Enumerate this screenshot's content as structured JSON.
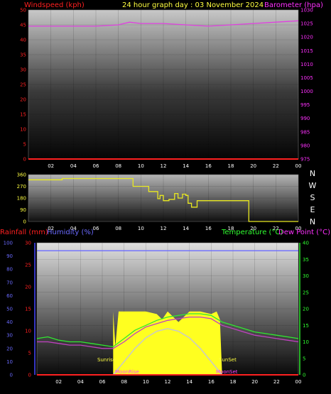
{
  "header": {
    "title": "24 hour graph day : 03 November 2024",
    "left_label": "Windspeed (kph)",
    "right_label": "Barometer (hpa)"
  },
  "compass": [
    "N",
    "W",
    "S",
    "E",
    "N"
  ],
  "panel3": {
    "left_label_1": "Rainfall (mm)",
    "left_label_2": "Humidity (%)",
    "right_label_1": "Temperature (°C)",
    "right_label_2": "Dew Point (°C)",
    "sunrise_label": "Sunrise",
    "sunset_label": "SunSet",
    "moonrise_label": "MoonRise",
    "moonset_label": "MoonSet"
  },
  "chart_data": [
    {
      "type": "line",
      "x_ticks": [
        "02",
        "04",
        "06",
        "08",
        "10",
        "12",
        "14",
        "16",
        "18",
        "20",
        "22",
        "00"
      ],
      "yleft_ticks": [
        0,
        5,
        10,
        15,
        20,
        25,
        30,
        35,
        40,
        45,
        50
      ],
      "yleft_lim": [
        0,
        50
      ],
      "yright_ticks": [
        975,
        980,
        985,
        990,
        995,
        1000,
        1005,
        1010,
        1015,
        1020,
        1025,
        1030
      ],
      "yright_lim": [
        975,
        1030
      ],
      "series": [
        {
          "name": "Windspeed (kph)",
          "axis": "left",
          "color": "#ff2020",
          "x": [
            0,
            24
          ],
          "values": [
            0,
            0
          ]
        },
        {
          "name": "Barometer (hpa)",
          "axis": "right",
          "color": "#e040e0",
          "x": [
            0,
            2,
            4,
            6,
            8,
            9,
            10,
            12,
            14,
            16,
            18,
            20,
            22,
            24
          ],
          "values": [
            1024,
            1024,
            1024,
            1024,
            1024.5,
            1025.5,
            1025,
            1025,
            1024.5,
            1024,
            1024.5,
            1025,
            1025.5,
            1026
          ]
        }
      ]
    },
    {
      "type": "line",
      "x_ticks": [
        "02",
        "04",
        "06",
        "08",
        "10",
        "12",
        "14",
        "16",
        "18",
        "20",
        "22",
        "00"
      ],
      "y_ticks": [
        0,
        90,
        180,
        270,
        360
      ],
      "ylim": [
        0,
        360
      ],
      "series": [
        {
          "name": "Wind direction",
          "color": "#e8e820",
          "x": [
            0,
            2,
            3,
            5,
            8,
            9,
            9.3,
            10.5,
            10.7,
            11,
            11.5,
            11.7,
            12,
            12.5,
            13,
            13.3,
            13.7,
            14,
            14.2,
            14.5,
            15,
            17,
            18,
            19,
            19.5,
            19.6,
            24
          ],
          "values": [
            320,
            320,
            330,
            330,
            330,
            330,
            270,
            270,
            230,
            230,
            175,
            200,
            160,
            170,
            215,
            180,
            210,
            200,
            140,
            110,
            160,
            160,
            160,
            160,
            160,
            0,
            0
          ]
        }
      ]
    },
    {
      "type": "line",
      "x_ticks": [
        "02",
        "04",
        "06",
        "08",
        "10",
        "12",
        "14",
        "16",
        "18",
        "20",
        "22",
        "00"
      ],
      "yleft1_ticks": [
        0,
        5,
        10,
        15,
        20,
        25,
        30
      ],
      "yleft1_lim": [
        0,
        30
      ],
      "yleft2_ticks": [
        0,
        10,
        20,
        30,
        40,
        50,
        60,
        70,
        80,
        90,
        100
      ],
      "yleft2_lim": [
        0,
        100
      ],
      "yright_ticks": [
        0,
        5,
        10,
        15,
        20,
        25,
        30,
        35,
        40
      ],
      "yright_lim": [
        0,
        40
      ],
      "series": [
        {
          "name": "Temperature (°C)",
          "axis": "right",
          "color": "#30e830",
          "x": [
            0,
            1,
            2,
            3,
            4,
            5,
            6,
            7,
            8,
            9,
            10,
            11,
            12,
            13,
            14,
            15,
            16,
            17,
            18,
            19,
            20,
            21,
            22,
            23,
            24
          ],
          "values": [
            11,
            11.5,
            10.5,
            10,
            10,
            9.5,
            9,
            8.5,
            11,
            13.5,
            15,
            16.5,
            17.5,
            18,
            18.5,
            18.5,
            18,
            16,
            15,
            14,
            13,
            12.5,
            12,
            11.5,
            11
          ]
        },
        {
          "name": "Dew Point (°C)",
          "axis": "right",
          "color": "#c040c0",
          "x": [
            0,
            1,
            2,
            3,
            4,
            5,
            6,
            7,
            8,
            9,
            10,
            11,
            12,
            13,
            14,
            15,
            16,
            17,
            18,
            19,
            20,
            21,
            22,
            23,
            24
          ],
          "values": [
            10,
            10,
            9.5,
            9,
            9,
            8.5,
            8,
            8,
            10,
            12.5,
            14.5,
            15.5,
            16.5,
            17,
            17.5,
            17.5,
            17,
            15,
            14,
            13,
            12,
            11.5,
            11,
            10.5,
            10
          ]
        },
        {
          "name": "Humidity (%)",
          "axis": "left2",
          "color": "#6a6aff",
          "x": [
            0,
            24
          ],
          "values": [
            94,
            94
          ]
        },
        {
          "name": "Solar",
          "axis": "left2",
          "color": "#ffff20",
          "x": [
            7.0,
            7.2,
            7.5,
            8,
            9,
            10,
            11,
            11.5,
            12,
            12.5,
            13,
            14,
            15,
            16,
            16.5,
            16.8,
            17.0
          ],
          "values": [
            48,
            22,
            48,
            48,
            48,
            48,
            46,
            42,
            48,
            44,
            40,
            48,
            48,
            46,
            48,
            42,
            0
          ]
        },
        {
          "name": "Solar max",
          "axis": "left2",
          "color": "#c8c8c8",
          "x": [
            7,
            8,
            9,
            10,
            11,
            12,
            13,
            14,
            15,
            16,
            17
          ],
          "values": [
            0,
            10,
            20,
            28,
            33,
            35,
            33,
            28,
            20,
            10,
            0
          ]
        },
        {
          "name": "Rainfall (mm)",
          "axis": "left1",
          "color": "#ff2020",
          "x": [
            0,
            24
          ],
          "values": [
            0,
            0
          ]
        }
      ]
    }
  ]
}
